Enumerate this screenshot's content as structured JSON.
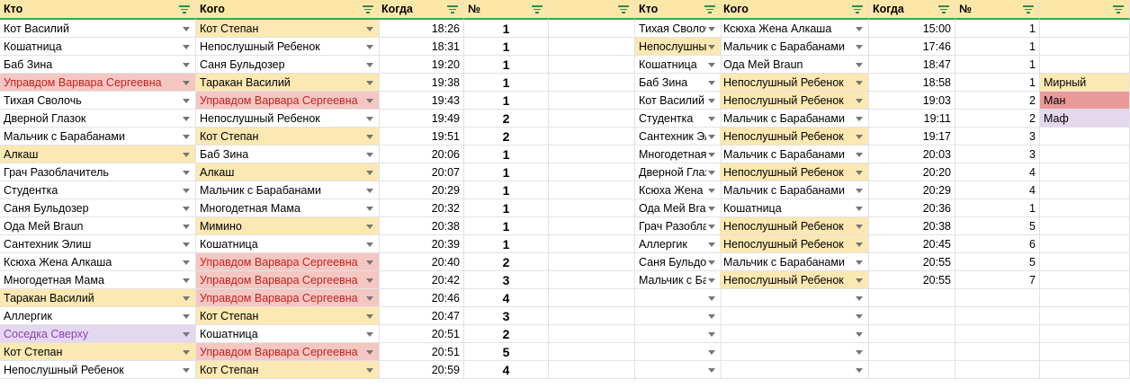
{
  "left": {
    "headers": [
      "Кто",
      "Кого",
      "Когда",
      "№",
      ""
    ],
    "rows": [
      {
        "who": "Кот Василий",
        "whom": "Кот Степан",
        "when": "18:26",
        "num": "1",
        "who_color": "",
        "whom_color": "#fce8b2"
      },
      {
        "who": "Кошатница",
        "whom": "Непослушный Ребенок",
        "when": "18:31",
        "num": "1",
        "who_color": "",
        "whom_color": ""
      },
      {
        "who": "Баб Зина",
        "whom": "Саня Бульдозер",
        "when": "19:20",
        "num": "1",
        "who_color": "",
        "whom_color": ""
      },
      {
        "who": "Управдом Варвара Сергеевна",
        "whom": "Таракан Василий",
        "when": "19:38",
        "num": "1",
        "who_color": "#f4c7c3",
        "whom_color": "#fce8b2"
      },
      {
        "who": "Тихая Сволочь",
        "whom": "Управдом Варвара Сергеевна",
        "when": "19:43",
        "num": "1",
        "who_color": "",
        "whom_color": "#f4c7c3"
      },
      {
        "who": "Дверной Глазок",
        "whom": "Непослушный Ребенок",
        "when": "19:49",
        "num": "2",
        "who_color": "",
        "whom_color": ""
      },
      {
        "who": "Мальчик с Барабанами",
        "whom": "Кот Степан",
        "when": "19:51",
        "num": "2",
        "who_color": "",
        "whom_color": "#fce8b2"
      },
      {
        "who": "Алкаш",
        "whom": "Баб Зина",
        "when": "20:06",
        "num": "1",
        "who_color": "#fce8b2",
        "whom_color": ""
      },
      {
        "who": "Грач Разоблачитель",
        "whom": "Алкаш",
        "when": "20:07",
        "num": "1",
        "who_color": "",
        "whom_color": "#fce8b2"
      },
      {
        "who": "Студентка",
        "whom": "Мальчик с Барабанами",
        "when": "20:29",
        "num": "1",
        "who_color": "",
        "whom_color": ""
      },
      {
        "who": "Саня Бульдозер",
        "whom": "Многодетная Мама",
        "when": "20:32",
        "num": "1",
        "who_color": "",
        "whom_color": ""
      },
      {
        "who": "Ода Мей Braun",
        "whom": "Мимино",
        "when": "20:38",
        "num": "1",
        "who_color": "",
        "whom_color": "#fce8b2"
      },
      {
        "who": "Сантехник Элиш",
        "whom": "Кошатница",
        "when": "20:39",
        "num": "1",
        "who_color": "",
        "whom_color": ""
      },
      {
        "who": "Ксюха Жена Алкаша",
        "whom": "Управдом Варвара Сергеевна",
        "when": "20:40",
        "num": "2",
        "who_color": "",
        "whom_color": "#f4c7c3"
      },
      {
        "who": "Многодетная Мама",
        "whom": "Управдом Варвара Сергеевна",
        "when": "20:42",
        "num": "3",
        "who_color": "",
        "whom_color": "#f4c7c3"
      },
      {
        "who": "Таракан Василий",
        "whom": "Управдом Варвара Сергеевна",
        "when": "20:46",
        "num": "4",
        "who_color": "#fce8b2",
        "whom_color": "#f4c7c3"
      },
      {
        "who": "Аллергик",
        "whom": "Кот Степан",
        "when": "20:47",
        "num": "3",
        "who_color": "",
        "whom_color": "#fce8b2"
      },
      {
        "who": "Соседка Сверху",
        "whom": "Кошатница",
        "when": "20:51",
        "num": "2",
        "who_color": "#e4d7f0",
        "whom_color": ""
      },
      {
        "who": "Кот Степан",
        "whom": "Управдом Варвара Сергеевна",
        "when": "20:51",
        "num": "5",
        "who_color": "#fce8b2",
        "whom_color": "#f4c7c3"
      },
      {
        "who": "Непослушный Ребенок",
        "whom": "Кот Степан",
        "when": "20:59",
        "num": "4",
        "who_color": "",
        "whom_color": "#fce8b2"
      }
    ]
  },
  "right": {
    "headers": [
      "Кто",
      "Кого",
      "Когда",
      "№",
      ""
    ],
    "rows": [
      {
        "who": "Тихая Сволочь",
        "whom": "Ксюха Жена Алкаша",
        "when": "15:00",
        "num": "1",
        "who_color": "",
        "whom_color": ""
      },
      {
        "who": "Непослушный Ребенок",
        "whom": "Мальчик с Барабанами",
        "when": "17:46",
        "num": "1",
        "who_color": "#fce8b2",
        "whom_color": ""
      },
      {
        "who": "Кошатница",
        "whom": "Ода Мей Braun",
        "when": "18:47",
        "num": "1",
        "who_color": "",
        "whom_color": ""
      },
      {
        "who": "Баб Зина",
        "whom": "Непослушный Ребенок",
        "when": "18:58",
        "num": "1",
        "who_color": "",
        "whom_color": "#fce8b2"
      },
      {
        "who": "Кот Василий",
        "whom": "Непослушный Ребенок",
        "when": "19:03",
        "num": "2",
        "who_color": "",
        "whom_color": "#fce8b2"
      },
      {
        "who": "Студентка",
        "whom": "Мальчик с Барабанами",
        "when": "19:11",
        "num": "2",
        "who_color": "",
        "whom_color": ""
      },
      {
        "who": "Сантехник Элиш",
        "whom": "Непослушный Ребенок",
        "when": "19:17",
        "num": "3",
        "who_color": "",
        "whom_color": "#fce8b2"
      },
      {
        "who": "Многодетная Мама",
        "whom": "Мальчик с Барабанами",
        "when": "20:03",
        "num": "3",
        "who_color": "",
        "whom_color": ""
      },
      {
        "who": "Дверной Глазок",
        "whom": "Непослушный Ребенок",
        "when": "20:20",
        "num": "4",
        "who_color": "",
        "whom_color": "#fce8b2"
      },
      {
        "who": "Ксюха Жена Алкаша",
        "whom": "Мальчик с Барабанами",
        "when": "20:29",
        "num": "4",
        "who_color": "",
        "whom_color": ""
      },
      {
        "who": "Ода Мей Braun",
        "whom": "Кошатница",
        "when": "20:36",
        "num": "1",
        "who_color": "",
        "whom_color": ""
      },
      {
        "who": "Грач Разоблачитель",
        "whom": "Непослушный Ребенок",
        "when": "20:38",
        "num": "5",
        "who_color": "",
        "whom_color": "#fce8b2"
      },
      {
        "who": "Аллергик",
        "whom": "Непослушный Ребенок",
        "when": "20:45",
        "num": "6",
        "who_color": "",
        "whom_color": "#fce8b2"
      },
      {
        "who": "Саня Бульдозер",
        "whom": "Мальчик с Барабанами",
        "when": "20:55",
        "num": "5",
        "who_color": "",
        "whom_color": ""
      },
      {
        "who": "Мальчик с Барабанами",
        "whom": "Непослушный Ребенок",
        "when": "20:55",
        "num": "7",
        "who_color": "",
        "whom_color": "#fce8b2"
      }
    ],
    "empty_rows": 5
  },
  "legend": [
    {
      "label": "Мирный",
      "color": "#fce8b2"
    },
    {
      "label": "Ман",
      "color": "#ea9999"
    },
    {
      "label": "Маф",
      "color": "#e4d7f0"
    }
  ],
  "colors": {
    "header": "#fde7a8",
    "yellow": "#fce8b2",
    "red": "#f4c7c3",
    "purple": "#e4d7f0",
    "red_text": "#c5221f",
    "purple_text": "#8e44ad",
    "filter_icon": "#2d8c4e"
  }
}
